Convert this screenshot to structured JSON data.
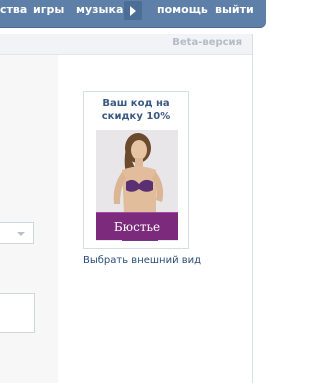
{
  "top_nav": {
    "items": [
      {
        "label": "ства"
      },
      {
        "label": "игры"
      },
      {
        "label": "музыка"
      },
      {
        "label": "помощь"
      },
      {
        "label": "выйти"
      }
    ],
    "more_icon": "play-triangle-icon"
  },
  "subbar": {
    "beta_label": "Beta-версия"
  },
  "ad": {
    "title": "Ваш код на скидку 10%",
    "logo_text": "Бюстье"
  },
  "choose_view_link": "Выбрать внешний вид",
  "colors": {
    "nav_background": "#5d7fa8",
    "link": "#2b4d78",
    "ad_logo_purple": "#7c2a7b"
  }
}
